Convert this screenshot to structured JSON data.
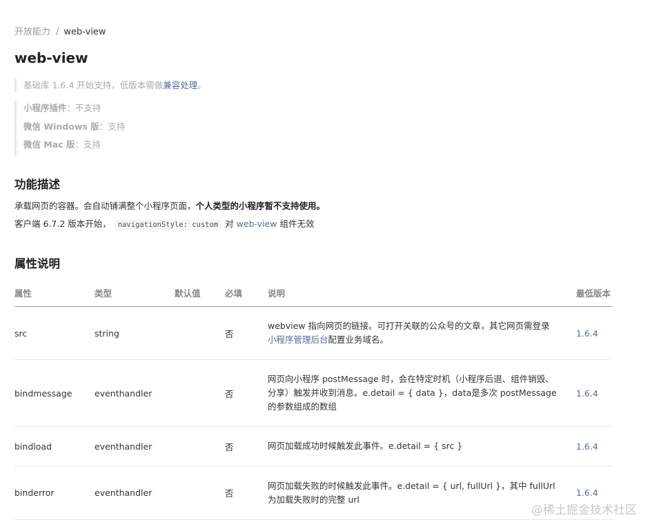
{
  "breadcrumb": {
    "parent": "开放能力",
    "separator": "/",
    "current": "web-view"
  },
  "title": "web-view",
  "support_note": {
    "prefix": "基础库 1.6.4 开始支持，低版本需做",
    "link": "兼容处理",
    "suffix": "。"
  },
  "platforms": [
    {
      "name": "小程序插件",
      "sep": "：",
      "status": "不支持"
    },
    {
      "name": "微信 Windows 版",
      "sep": "：",
      "status": "支持"
    },
    {
      "name": "微信 Mac 版",
      "sep": "：",
      "status": "支持"
    }
  ],
  "feature_section": {
    "title": "功能描述",
    "line1_normal": "承载网页的容器。会自动铺满整个小程序页面，",
    "line1_bold": "个人类型的小程序暂不支持使用。",
    "line2_prefix": "客户端 6.7.2 版本开始，",
    "line2_code": "navigationStyle: custom",
    "line2_middle": "对 ",
    "line2_link": "web-view",
    "line2_suffix": " 组件无效"
  },
  "props_section": {
    "title": "属性说明",
    "headers": {
      "attr": "属性",
      "type": "类型",
      "default": "默认值",
      "required": "必填",
      "desc": "说明",
      "min_version": "最低版本"
    },
    "rows": [
      {
        "attr": "src",
        "type": "string",
        "default": "",
        "required": "否",
        "desc_text": "webview 指向网页的链接。可打开关联的公众号的文章，其它网页需登录",
        "desc_link": "小程序管理后台",
        "desc_suffix": "配置业务域名。",
        "min_version": "1.6.4"
      },
      {
        "attr": "bindmessage",
        "type": "eventhandler",
        "default": "",
        "required": "否",
        "desc_text": "网页向小程序 postMessage 时，会在特定时机（小程序后退、组件销毁、分享）触发并收到消息。e.detail = { data }，data是多次 postMessage 的参数组成的数组",
        "min_version": "1.6.4"
      },
      {
        "attr": "bindload",
        "type": "eventhandler",
        "default": "",
        "required": "否",
        "desc_text": "网页加载成功时候触发此事件。e.detail = { src }",
        "min_version": "1.6.4"
      },
      {
        "attr": "binderror",
        "type": "eventhandler",
        "default": "",
        "required": "否",
        "desc_text": "网页加载失败的时候触发此事件。e.detail = { url, fullUrl }，其中 fullUrl 为加载失败时的完整 url",
        "min_version": "1.6.4"
      }
    ]
  },
  "watermark": "@稀土掘金技术社区",
  "colors": {
    "link": "#576b95",
    "text": "#333333",
    "muted": "#999999",
    "header_text": "#888888"
  }
}
